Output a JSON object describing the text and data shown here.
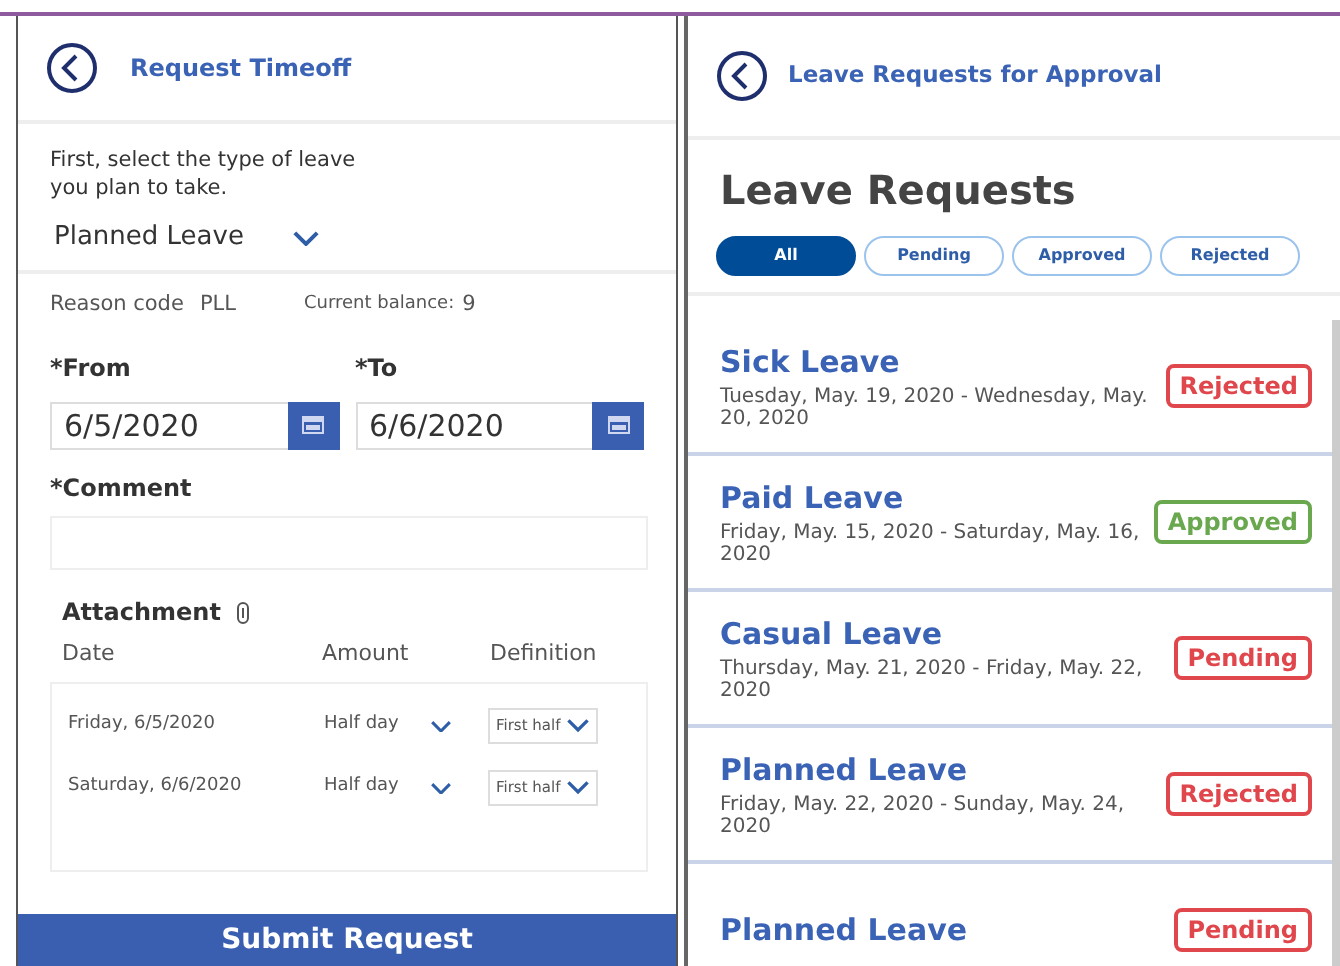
{
  "left_screen": {
    "title": "Request Timeoff",
    "instruction": "First, select the type of leave you plan to take.",
    "leave_type": "Planned Leave",
    "reason_label": "Reason code",
    "reason_value": "PLL",
    "balance_label": "Current balance:",
    "balance_value": "9",
    "from": {
      "label": "*From",
      "value": "6/5/2020"
    },
    "to": {
      "label": "*To",
      "value": "6/6/2020"
    },
    "comment": {
      "label": "*Comment"
    },
    "attachment_label": "Attachment",
    "table": {
      "columns": [
        "Date",
        "Amount",
        "Definition"
      ],
      "rows": [
        {
          "date": "Friday, 6/5/2020",
          "amount": "Half day",
          "definition": "First half"
        },
        {
          "date": "Saturday, 6/6/2020",
          "amount": "Half day",
          "definition": "First half"
        }
      ]
    },
    "submit": "Submit Request"
  },
  "right_screen": {
    "title": "Leave Requests for Approval",
    "heading": "Leave Requests",
    "filters": [
      {
        "label": "All",
        "selected": true
      },
      {
        "label": "Pending",
        "selected": false
      },
      {
        "label": "Approved",
        "selected": false
      },
      {
        "label": "Rejected",
        "selected": false
      }
    ],
    "requests": [
      {
        "type": "Sick Leave",
        "dates": "Tuesday, May. 19, 2020 - Wednesday, May. 20, 2020",
        "status": "Rejected",
        "color": "#e0474c"
      },
      {
        "type": "Paid Leave",
        "dates": "Friday, May. 15, 2020 - Saturday, May. 16, 2020",
        "status": "Approved",
        "color": "#6aa84f"
      },
      {
        "type": "Casual Leave",
        "dates": "Thursday, May. 21, 2020 - Friday, May. 22, 2020",
        "status": "Pending",
        "color": "#e0474c"
      },
      {
        "type": "Planned Leave",
        "dates": "Friday, May. 22, 2020 - Sunday, May. 24, 2020",
        "status": "Rejected",
        "color": "#e0474c"
      },
      {
        "type": "Planned Leave",
        "status": "Pending",
        "color": "#e0474c"
      }
    ]
  }
}
